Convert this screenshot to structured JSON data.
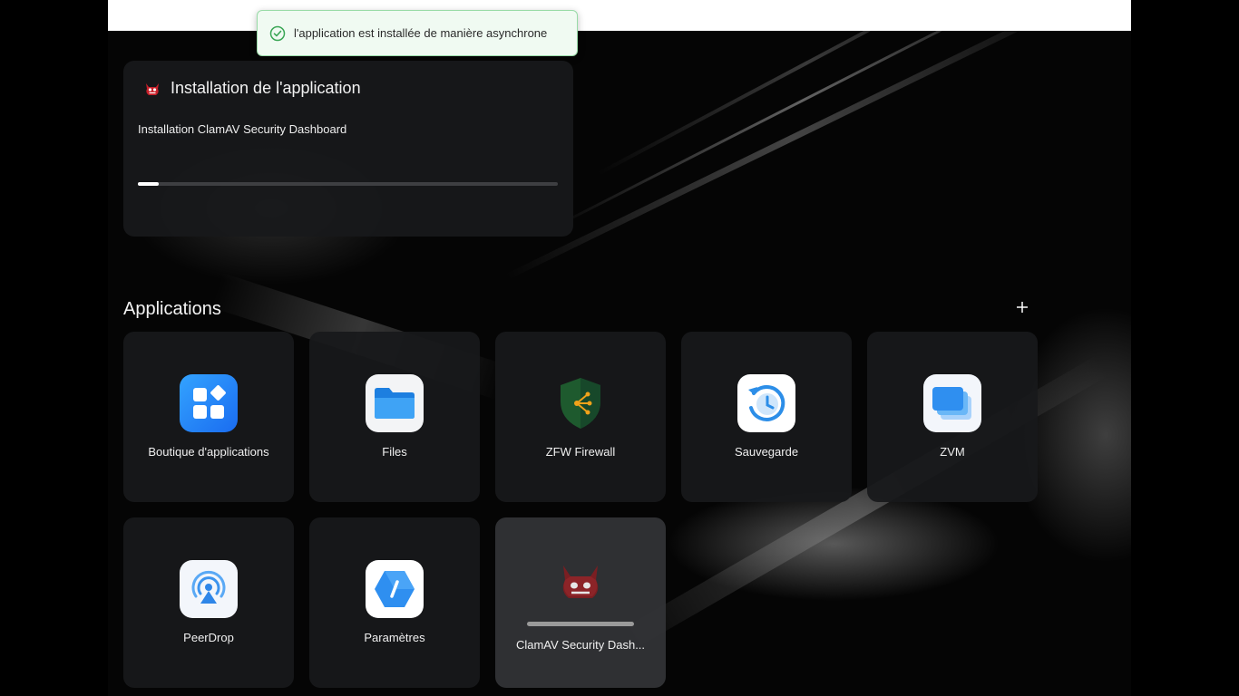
{
  "toast": {
    "icon": "check-circle-icon",
    "message": "l'application est installée de manière asynchrone",
    "accent": "#3aa655"
  },
  "install": {
    "icon": "clamav-logo",
    "title": "Installation de l'application",
    "subtitle": "Installation ClamAV Security Dashboard",
    "progress": 0.05
  },
  "applications": {
    "heading": "Applications",
    "add_icon": "plus-icon",
    "items": [
      {
        "label": "Boutique d'applications",
        "icon": "app-store-icon"
      },
      {
        "label": "Files",
        "icon": "folder-icon"
      },
      {
        "label": "ZFW Firewall",
        "icon": "shield-icon"
      },
      {
        "label": "Sauvegarde",
        "icon": "backup-clock-icon"
      },
      {
        "label": "ZVM",
        "icon": "vm-windows-icon"
      },
      {
        "label": "PeerDrop",
        "icon": "airdrop-icon"
      },
      {
        "label": "Paramètres",
        "icon": "settings-hexagon-icon"
      },
      {
        "label": "ClamAV Security Dash...",
        "icon": "clamav-icon",
        "installing": true
      }
    ]
  }
}
